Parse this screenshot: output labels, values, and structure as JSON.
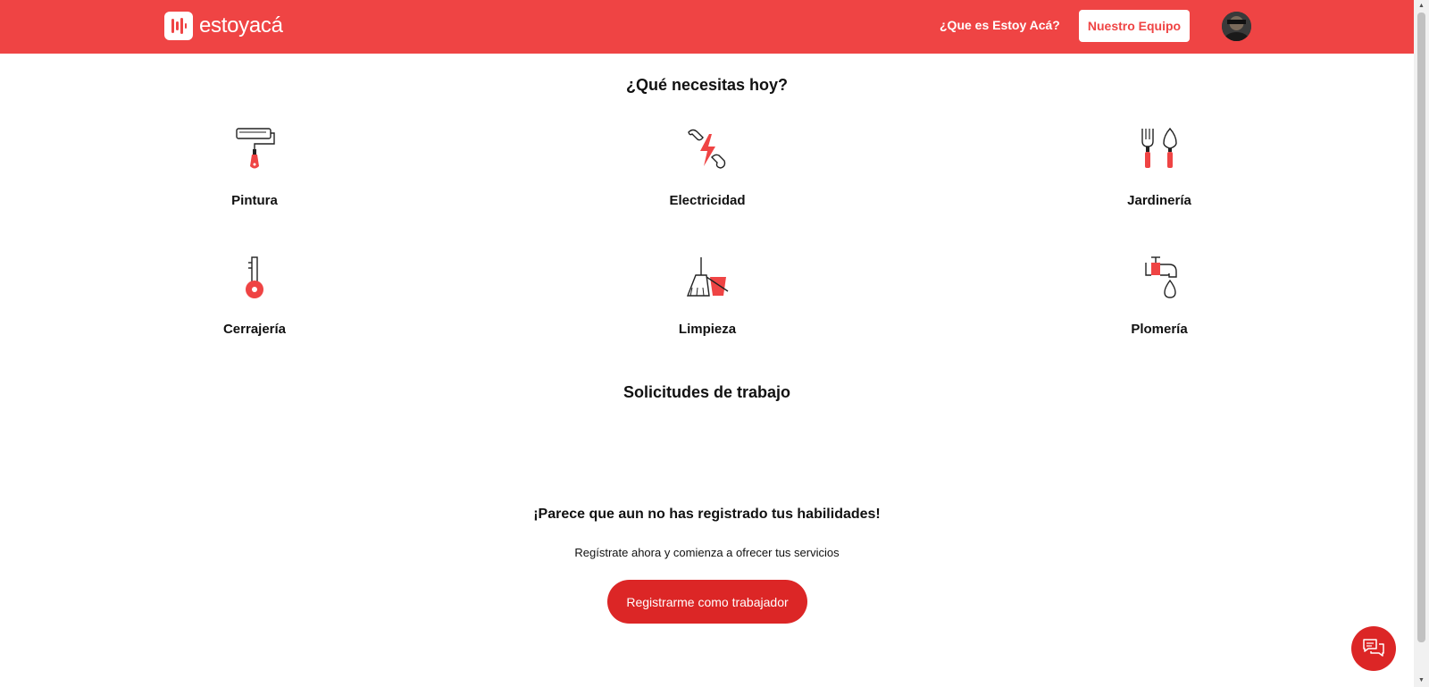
{
  "header": {
    "logo_text": "estoyacá",
    "nav_link": "¿Que es Estoy Acá?",
    "nav_button": "Nuestro Equipo"
  },
  "categories_title": "¿Qué necesitas hoy?",
  "categories": [
    {
      "label": "Pintura",
      "icon": "paint-roller-icon"
    },
    {
      "label": "Electricidad",
      "icon": "electricity-icon"
    },
    {
      "label": "Jardinería",
      "icon": "gardening-icon"
    },
    {
      "label": "Cerrajería",
      "icon": "key-icon"
    },
    {
      "label": "Limpieza",
      "icon": "broom-bucket-icon"
    },
    {
      "label": "Plomería",
      "icon": "faucet-icon"
    }
  ],
  "requests_title": "Solicitudes de trabajo",
  "empty_state": {
    "title": "¡Parece que aun no has registrado tus habilidades!",
    "subtitle": "Regístrate ahora y comienza a ofrecer tus servicios",
    "button": "Registrarme como trabajador"
  },
  "colors": {
    "brand": "#ef4444",
    "button": "#dc2626"
  }
}
